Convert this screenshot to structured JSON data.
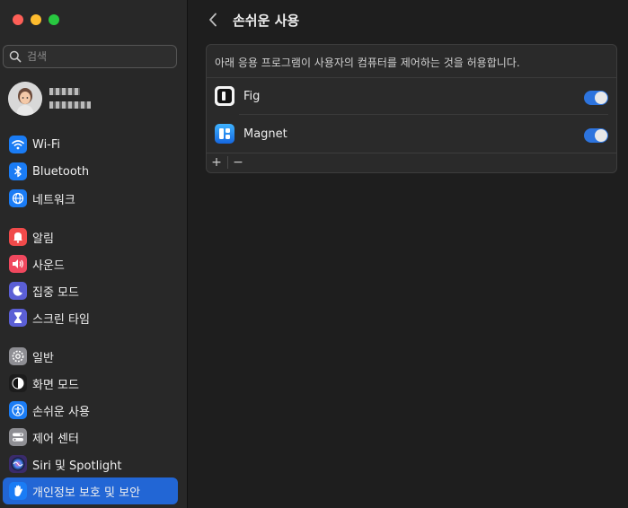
{
  "sidebar": {
    "search_placeholder": "검색",
    "profile": {
      "line1": " ",
      "line2": " "
    },
    "items": [
      {
        "label": "Wi-Fi",
        "icon": "wifi-icon",
        "color": "#1a7cf5"
      },
      {
        "label": "Bluetooth",
        "icon": "bluetooth-icon",
        "color": "#1a7cf5"
      },
      {
        "label": "네트워크",
        "icon": "globe-icon",
        "color": "#1a7cf5"
      },
      {
        "label": "알림",
        "icon": "bell-icon",
        "color": "#f04a4a"
      },
      {
        "label": "사운드",
        "icon": "speaker-icon",
        "color": "#f0485e"
      },
      {
        "label": "집중 모드",
        "icon": "moon-icon",
        "color": "#5b5fd6"
      },
      {
        "label": "스크린 타임",
        "icon": "hourglass-icon",
        "color": "#5b5fd6"
      },
      {
        "label": "일반",
        "icon": "gear-icon",
        "color": "#8e8e93"
      },
      {
        "label": "화면 모드",
        "icon": "appearance-icon",
        "color": "#1c1c1c"
      },
      {
        "label": "손쉬운 사용",
        "icon": "accessibility-icon",
        "color": "#1a7cf5"
      },
      {
        "label": "제어 센터",
        "icon": "control-center-icon",
        "color": "#8e8e93"
      },
      {
        "label": "Siri 및 Spotlight",
        "icon": "siri-icon",
        "color": "#3a2b6b"
      },
      {
        "label": "개인정보 보호 및 보안",
        "icon": "hand-icon",
        "color": "#1a7cf5",
        "active": true
      }
    ]
  },
  "main": {
    "title": "손쉬운 사용",
    "description": "아래 응용 프로그램이 사용자의 컴퓨터를 제어하는 것을 허용합니다.",
    "apps": [
      {
        "name": "Fig",
        "icon": "fig-icon",
        "enabled": true
      },
      {
        "name": "Magnet",
        "icon": "magnet-icon",
        "enabled": true
      }
    ],
    "add_label": "+",
    "remove_label": "−"
  },
  "colors": {
    "accent": "#2266d5",
    "toggle_on": "#2d74de"
  }
}
